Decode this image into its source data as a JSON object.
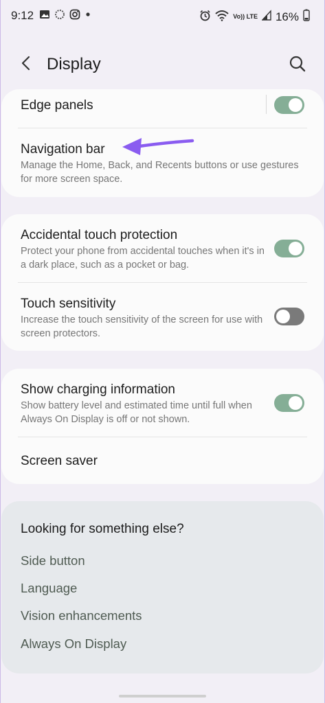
{
  "status_bar": {
    "time": "9:12",
    "battery": "16%",
    "network_label": "Vo)) LTE"
  },
  "header": {
    "title": "Display"
  },
  "card1": {
    "edge_panels": {
      "title": "Edge panels",
      "toggle": "on"
    },
    "navigation_bar": {
      "title": "Navigation bar",
      "description": "Manage the Home, Back, and Recents buttons or use gestures for more screen space."
    }
  },
  "card2": {
    "accidental_touch": {
      "title": "Accidental touch protection",
      "description": "Protect your phone from accidental touches when it's in a dark place, such as a pocket or bag.",
      "toggle": "on"
    },
    "touch_sensitivity": {
      "title": "Touch sensitivity",
      "description": "Increase the touch sensitivity of the screen for use with screen protectors.",
      "toggle": "off"
    }
  },
  "card3": {
    "charging_info": {
      "title": "Show charging information",
      "description": "Show battery level and estimated time until full when Always On Display is off or not shown.",
      "toggle": "on"
    },
    "screen_saver": {
      "title": "Screen saver"
    }
  },
  "suggestions": {
    "title": "Looking for something else?",
    "links": [
      "Side button",
      "Language",
      "Vision enhancements",
      "Always On Display"
    ]
  },
  "colors": {
    "toggle_on": "#85ae96",
    "toggle_off": "#7a7a7a",
    "annotation_arrow": "#8a5cf0"
  }
}
